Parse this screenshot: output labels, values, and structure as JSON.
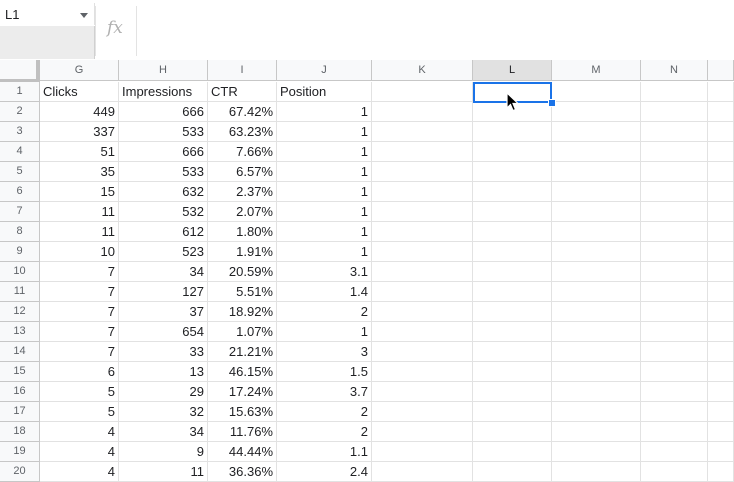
{
  "name_box": {
    "value": "L1"
  },
  "formula_bar": {
    "fx_label": "fx",
    "value": ""
  },
  "columns": [
    {
      "label": "G"
    },
    {
      "label": "H"
    },
    {
      "label": "I"
    },
    {
      "label": "J"
    },
    {
      "label": "K"
    },
    {
      "label": "L"
    },
    {
      "label": "M"
    },
    {
      "label": "N"
    }
  ],
  "selected_cell": "L1",
  "rows": [
    {
      "n": "1",
      "cells": [
        "Clicks",
        "Impressions",
        "CTR",
        "Position"
      ]
    },
    {
      "n": "2",
      "cells": [
        "449",
        "666",
        "67.42%",
        "1"
      ]
    },
    {
      "n": "3",
      "cells": [
        "337",
        "533",
        "63.23%",
        "1"
      ]
    },
    {
      "n": "4",
      "cells": [
        "51",
        "666",
        "7.66%",
        "1"
      ]
    },
    {
      "n": "5",
      "cells": [
        "35",
        "533",
        "6.57%",
        "1"
      ]
    },
    {
      "n": "6",
      "cells": [
        "15",
        "632",
        "2.37%",
        "1"
      ]
    },
    {
      "n": "7",
      "cells": [
        "11",
        "532",
        "2.07%",
        "1"
      ]
    },
    {
      "n": "8",
      "cells": [
        "11",
        "612",
        "1.80%",
        "1"
      ]
    },
    {
      "n": "9",
      "cells": [
        "10",
        "523",
        "1.91%",
        "1"
      ]
    },
    {
      "n": "10",
      "cells": [
        "7",
        "34",
        "20.59%",
        "3.1"
      ]
    },
    {
      "n": "11",
      "cells": [
        "7",
        "127",
        "5.51%",
        "1.4"
      ]
    },
    {
      "n": "12",
      "cells": [
        "7",
        "37",
        "18.92%",
        "2"
      ]
    },
    {
      "n": "13",
      "cells": [
        "7",
        "654",
        "1.07%",
        "1"
      ]
    },
    {
      "n": "14",
      "cells": [
        "7",
        "33",
        "21.21%",
        "3"
      ]
    },
    {
      "n": "15",
      "cells": [
        "6",
        "13",
        "46.15%",
        "1.5"
      ]
    },
    {
      "n": "16",
      "cells": [
        "5",
        "29",
        "17.24%",
        "3.7"
      ]
    },
    {
      "n": "17",
      "cells": [
        "5",
        "32",
        "15.63%",
        "2"
      ]
    },
    {
      "n": "18",
      "cells": [
        "4",
        "34",
        "11.76%",
        "2"
      ]
    },
    {
      "n": "19",
      "cells": [
        "4",
        "9",
        "44.44%",
        "1.1"
      ]
    },
    {
      "n": "20",
      "cells": [
        "4",
        "11",
        "36.36%",
        "2.4"
      ]
    }
  ]
}
